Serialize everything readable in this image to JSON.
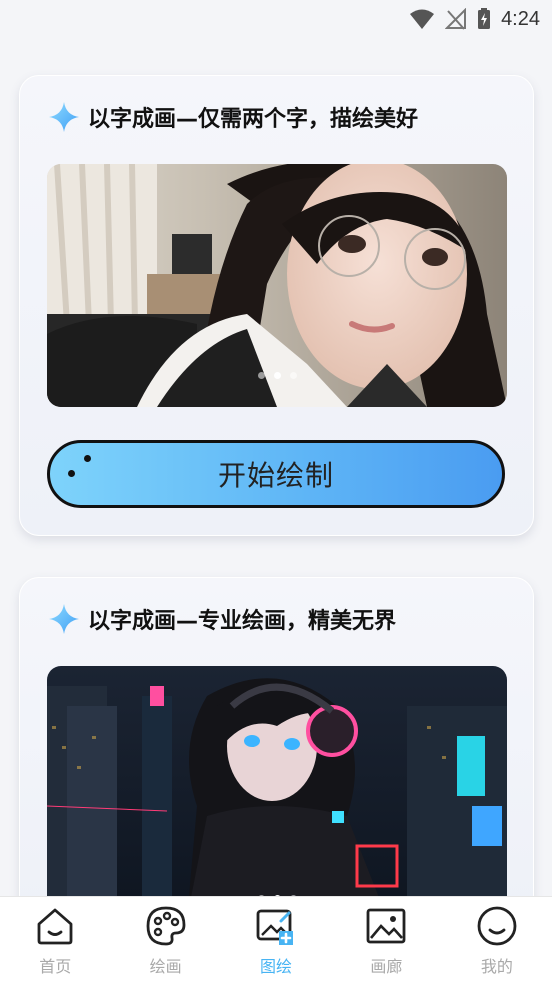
{
  "status_bar": {
    "time": "4:24"
  },
  "cards": [
    {
      "title": "以字成画—仅需两个字，描绘美好",
      "image": "portrait-girl-glasses",
      "dots": 3,
      "active_dot": 2,
      "button_label": "开始绘制"
    },
    {
      "title": "以字成画—专业绘画，精美无界",
      "image": "anime-girl-headphones-city",
      "dots": 3,
      "active_dot": 2
    }
  ],
  "bottom_nav": {
    "items": [
      {
        "label": "首页",
        "icon": "home-icon"
      },
      {
        "label": "绘画",
        "icon": "palette-icon"
      },
      {
        "label": "图绘",
        "icon": "image-add-icon",
        "active": true
      },
      {
        "label": "画廊",
        "icon": "gallery-icon"
      },
      {
        "label": "我的",
        "icon": "profile-icon"
      }
    ]
  },
  "colors": {
    "accent": "#48b4f3",
    "inactive": "#a9a9a9"
  }
}
